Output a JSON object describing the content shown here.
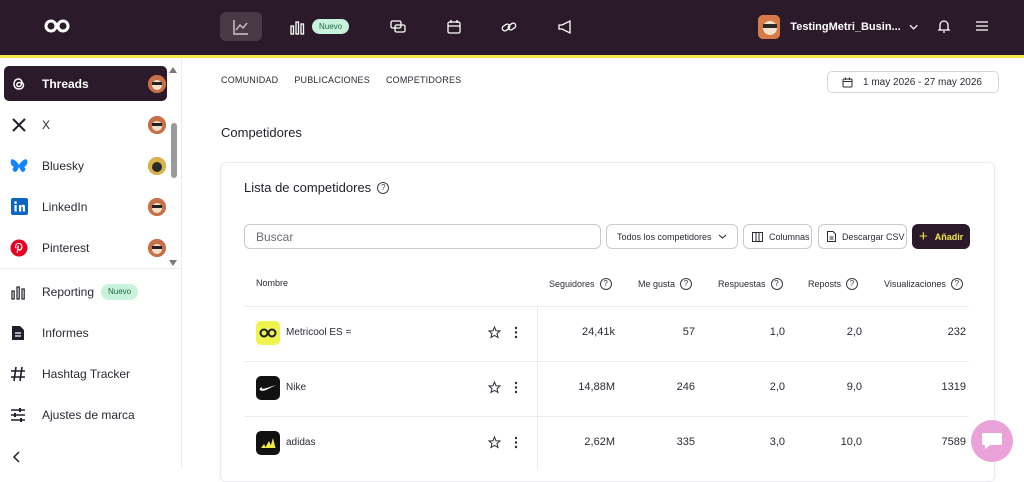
{
  "topnav": {
    "nuevo_badge": "Nuevo",
    "account_name": "TestingMetri_Busin..."
  },
  "sidebar": {
    "networks": [
      {
        "label": "Threads",
        "active": true
      },
      {
        "label": "X",
        "active": false
      },
      {
        "label": "Bluesky",
        "active": false
      },
      {
        "label": "LinkedIn",
        "active": false
      },
      {
        "label": "Pinterest",
        "active": false
      }
    ],
    "tools": [
      {
        "label": "Reporting",
        "badge": "Nuevo"
      },
      {
        "label": "Informes"
      },
      {
        "label": "Hashtag Tracker"
      },
      {
        "label": "Ajustes de marca"
      }
    ]
  },
  "tabs": [
    "COMUNIDAD",
    "PUBLICACIONES",
    "COMPETIDORES"
  ],
  "date_range": "1 may 2026 - 27 may 2026",
  "section_title": "Competidores",
  "card": {
    "title": "Lista de competidores",
    "search_placeholder": "Buscar",
    "filter_selected": "Todos los competidores",
    "columns_button": "Columnas",
    "download_button": "Descargar CSV",
    "add_button": "Añadir"
  },
  "table": {
    "headers": [
      "Nombre",
      "Seguidores",
      "Me gusta",
      "Respuestas",
      "Reposts",
      "Visualizaciones"
    ],
    "rows": [
      {
        "name": "Metricool ES =",
        "seguidores": "24,41k",
        "me_gusta": "57",
        "respuestas": "1,0",
        "reposts": "2,0",
        "visualizaciones": "232"
      },
      {
        "name": "Nike",
        "seguidores": "14,88M",
        "me_gusta": "246",
        "respuestas": "2,0",
        "reposts": "9,0",
        "visualizaciones": "1319"
      },
      {
        "name": "adidas",
        "seguidores": "2,62M",
        "me_gusta": "335",
        "respuestas": "3,0",
        "reposts": "10,0",
        "visualizaciones": "7589"
      }
    ]
  },
  "colors": {
    "topbar": "#2b1a29",
    "accent_yellow": "#f2e84b",
    "badge_green": "#c9f2dc",
    "chat_pink": "#e9a3d8"
  }
}
